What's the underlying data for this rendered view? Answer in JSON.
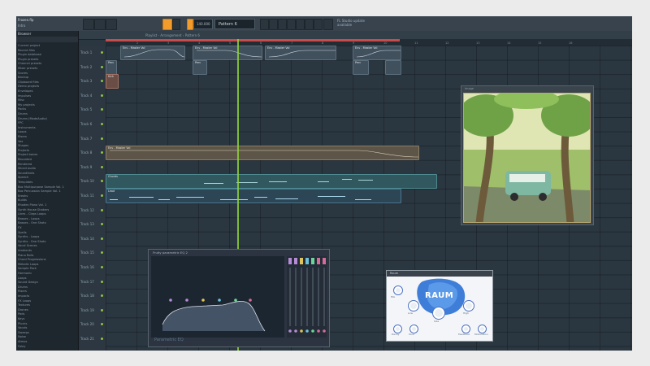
{
  "app": {
    "song_title": "Frozen.flp",
    "song_sub": "Intro",
    "tempo": "140.000",
    "pattern": "Pattern 6",
    "hint": "FL Studio update available"
  },
  "playlist": {
    "title": "Playlist - Arrangement › Pattern 6",
    "ruler": [
      "2",
      "3",
      "4",
      "5",
      "6",
      "7",
      "8",
      "9",
      "10",
      "11",
      "12",
      "13",
      "14",
      "15",
      "16"
    ],
    "tracks": [
      "Track 1",
      "Track 2",
      "Track 3",
      "Track 4",
      "Track 5",
      "Track 6",
      "Track 7",
      "Track 8",
      "Track 9",
      "Track 10",
      "Track 11",
      "Track 12",
      "Track 13",
      "Track 14",
      "Track 15",
      "Track 16",
      "Track 17",
      "Track 18",
      "Track 19",
      "Track 20",
      "Track 21"
    ],
    "clips": {
      "auto_a": "Env - Master Vol",
      "auto_b": "Env - Master Vol",
      "auto_c": "Env - Master Vol",
      "auto_d": "Env - Master Vol",
      "t3_a": "Perc",
      "t3_b": "Perc",
      "t3_c": "Perc",
      "t4": "Kick",
      "t8": "Env - Master Vol",
      "t10": "Chords",
      "t11": "Lead"
    }
  },
  "browser": {
    "title": "Browser",
    "items": [
      "Current project",
      "Recent files",
      "Plugin database",
      "Plugin presets",
      "Channel presets",
      "Mixer presets",
      "Scores",
      "Backup",
      "Clipboard files",
      "Demo projects",
      "Envelopes",
      "Impulses",
      "Misc",
      "My projects",
      "Packs",
      "Drums",
      "Drums (ModeAudio)",
      "FPC",
      "Instruments",
      "Loops",
      "Risers",
      "Vox",
      "Shapes",
      "Projects",
      "Project bones",
      "Recorded",
      "Rendered",
      "Sliced audio",
      "Soundfonts",
      "Speech",
      "Templates",
      "Box Multipurpose Sample Vol. 1",
      "Box Percussion Sample Vol. 1",
      "Breaks",
      "Builds",
      "Rhodes Piano Vol. 1",
      "Synth House Shakers",
      "Lines - Claps Loops",
      "Basses - Loops",
      "Basses - One Shots",
      "FX",
      "Spells",
      "Synths - Loops",
      "Synths - One Shots",
      "Vocal Scenes",
      "Ambients",
      "Piano Rolls",
      "Chord Progressions",
      "Melodic Loops",
      "Sample Pack",
      "Harmonic",
      "Loops",
      "Sound Design",
      "Drums",
      "Risers",
      "Impacts",
      "FX Loops",
      "Textures",
      "Drones",
      "Pads",
      "Keys",
      "Plucks",
      "Vocals",
      "Sweeps",
      "Noise",
      "Atmos",
      "Foley"
    ]
  },
  "image_window": {
    "title": "Image"
  },
  "eq": {
    "title": "Fruity parametric EQ 2",
    "brand": "Parametric EQ"
  },
  "raum": {
    "title": "Raum",
    "logo": "RAUM",
    "knobs": [
      "Mix",
      "Low",
      "High",
      "Size",
      "Decay",
      "Tone",
      "Feedback",
      "Modulation"
    ]
  },
  "colors": {
    "accent": "#f39b2b",
    "playhead": "#8ed13c",
    "ruler_loop": "#c94b4b",
    "grid_bg": "#2a3640"
  }
}
